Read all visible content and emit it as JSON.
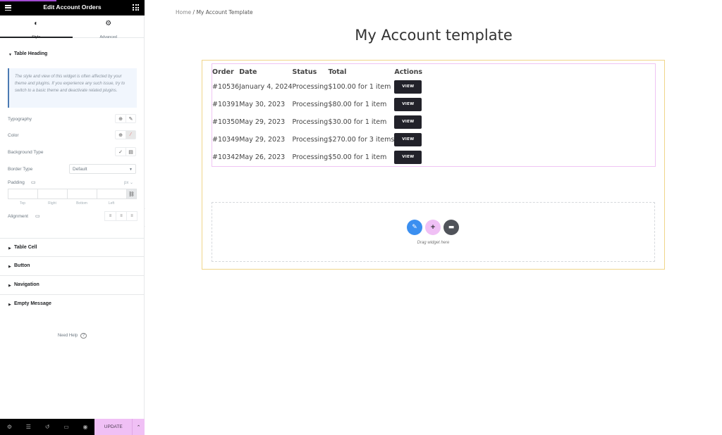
{
  "editor": {
    "title": "Edit Account Orders",
    "tabs": [
      {
        "label": "Style",
        "icon": "contrast-icon",
        "active": true
      },
      {
        "label": "Advanced",
        "icon": "gear-icon",
        "active": false
      }
    ],
    "sections": {
      "table_heading": "Table Heading",
      "table_cell": "Table Cell",
      "button": "Button",
      "navigation": "Navigation",
      "empty_message": "Empty Message"
    },
    "notice": "The style and view of this widget is often affected by your theme and plugins. If you experience any such issue, try to switch to a basic theme and deactivate related plugins.",
    "controls": {
      "typography": "Typography",
      "color": "Color",
      "background_type": "Background Type",
      "border_type": "Border Type",
      "border_type_value": "Default",
      "padding": "Padding",
      "padding_units": "px",
      "padding_labels": [
        "Top",
        "Right",
        "Bottom",
        "Left"
      ],
      "alignment": "Alignment"
    },
    "need_help": "Need Help",
    "update_label": "UPDATE"
  },
  "canvas": {
    "breadcrumb": {
      "home": "Home",
      "separator": " / ",
      "current": "My Account Template"
    },
    "page_title": "My Account template",
    "orders": {
      "headers": [
        "Order",
        "Date",
        "Status",
        "Total",
        "Actions"
      ],
      "rows": [
        {
          "order": "#10536",
          "date": "January 4, 2024",
          "status": "Processing",
          "total": "$100.00 for 1 item",
          "action": "VIEW"
        },
        {
          "order": "#10391",
          "date": "May 30, 2023",
          "status": "Processing",
          "total": "$80.00 for 1 item",
          "action": "VIEW"
        },
        {
          "order": "#10350",
          "date": "May 29, 2023",
          "status": "Processing",
          "total": "$30.00 for 1 item",
          "action": "VIEW"
        },
        {
          "order": "#10349",
          "date": "May 29, 2023",
          "status": "Processing",
          "total": "$270.00 for 3 items",
          "action": "VIEW"
        },
        {
          "order": "#10342",
          "date": "May 26, 2023",
          "status": "Processing",
          "total": "$50.00 for 1 item",
          "action": "VIEW"
        }
      ]
    },
    "dropzone_text": "Drag widget here"
  },
  "colors": {
    "accent_pink": "#f0c0f5",
    "button_dark": "#22222a",
    "edit_blue": "#3b8ff0",
    "section_border": "#f0d58a",
    "widget_border": "#efc4f3"
  }
}
